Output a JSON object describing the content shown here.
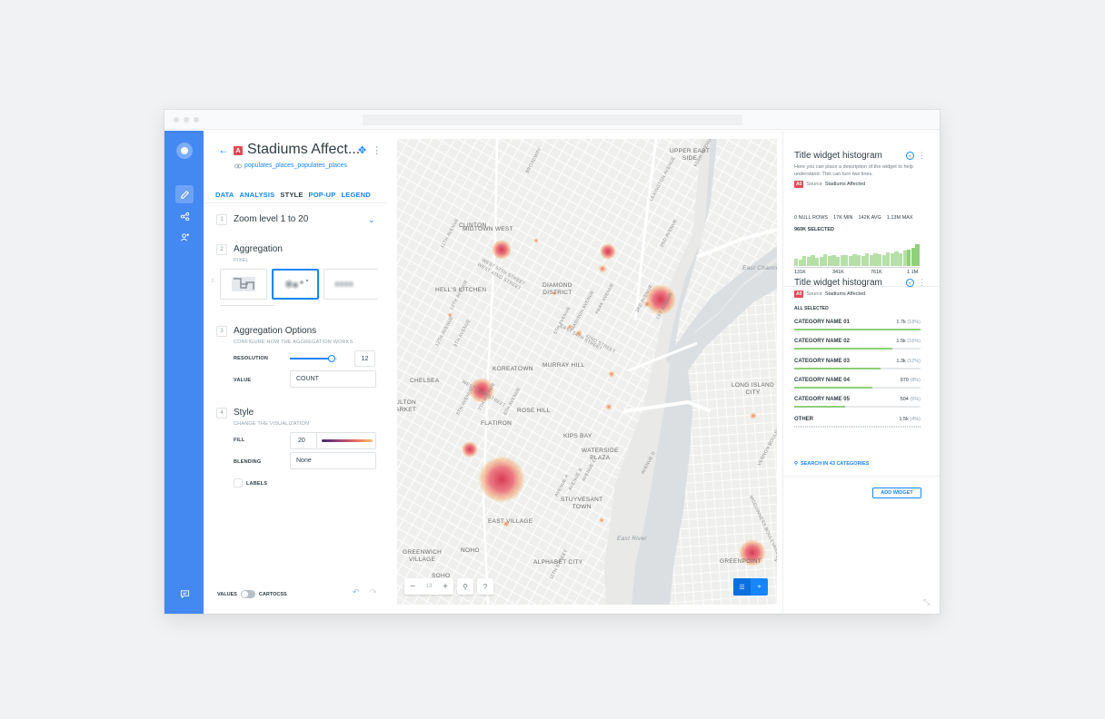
{
  "layer": {
    "back_icon": "arrow-left-icon",
    "badge": "A",
    "title": "Stadiums Affect...",
    "source": "populates_places_populates_places",
    "tabs": [
      "DATA",
      "ANALYSIS",
      "STYLE",
      "POP-UP",
      "LEGEND"
    ],
    "active_tab": "STYLE"
  },
  "sections": {
    "zoom": {
      "num": "1",
      "title": "Zoom level 1 to 20"
    },
    "aggregation": {
      "num": "2",
      "title": "Aggregation",
      "sub": "PIXEL",
      "prev_num": "3",
      "selected_option": "pixel-heatmap"
    },
    "options": {
      "num": "3",
      "title": "Aggregation Options",
      "sub": "CONFIGURE HOW THE AGGREGATION WORKS",
      "resolution_label": "RESOLUTION",
      "resolution_value": "12",
      "resolution_fraction": 0.89,
      "value_label": "VALUE",
      "value_value": "COUNT"
    },
    "style": {
      "num": "4",
      "title": "Style",
      "sub": "CHANGE THE VISUALIZATION",
      "fill_label": "FILL",
      "fill_value": "20",
      "blending_label": "BLENDING",
      "blending_value": "None",
      "labels_label": "LABELS"
    }
  },
  "footer": {
    "values_label": "VALUES",
    "cartocss_label": "CARTOCSS"
  },
  "map": {
    "labels": [
      {
        "t": "MIDTOWN WEST"
      },
      {
        "t": "CLINTON"
      },
      {
        "t": "HELL'S KITCHEN"
      },
      {
        "t": "DIAMOND DISTRICT"
      },
      {
        "t": "MURRAY HILL"
      },
      {
        "t": "KOREATOWN"
      },
      {
        "t": "CHELSEA"
      },
      {
        "t": "ROSE HILL"
      },
      {
        "t": "FLATIRON"
      },
      {
        "t": "KIPS BAY"
      },
      {
        "t": "WATERSIDE PLAZA"
      },
      {
        "t": "STUYVESANT TOWN"
      },
      {
        "t": "EAST VILLAGE"
      },
      {
        "t": "GREENWICH VILLAGE"
      },
      {
        "t": "NOHO"
      },
      {
        "t": "ALPHABET CITY"
      },
      {
        "t": "SOHO"
      },
      {
        "t": "GREENPOINT"
      },
      {
        "t": "LONG ISLAND CITY"
      },
      {
        "t": "ULTON ARKET"
      },
      {
        "t": "UPPER EAST SIDE"
      }
    ],
    "streets": [
      "BROADWAY",
      "11TH AVENUE",
      "10TH AVENUE",
      "9TH AVENUE",
      "8TH AVENUE",
      "7TH AVENUE",
      "6TH AVENUE",
      "5TH AVENUE",
      "MADISON AVENUE",
      "PARK AVENUE",
      "LEXINGTON AVENUE",
      "3RD AVENUE",
      "2ND AVENUE",
      "1ST AVENUE",
      "YORK AVENUE",
      "WEST 57TH STREET",
      "WEST 42ND STREET",
      "42ND STREET",
      "WEST 23RD STREET",
      "EAST 34TH STREET",
      "AVENUE A",
      "AVENUE B",
      "AVENUE C",
      "AVENUE D",
      "12TH AVENUE",
      "MCGUINNESS BOULEVARD",
      "11TH STREET",
      "VERNON BOULEVARD",
      "BEDFORD"
    ],
    "water": [
      "East River",
      "East Channel"
    ],
    "zoom": "13",
    "heat_color": "#e84a5f"
  },
  "widgets": {
    "histogram": {
      "title": "Title widget histogram",
      "description": "Here you can place a description of the widget to help understand. This can turn two lines.",
      "source_badge": "A0",
      "source_label": "Source",
      "source_name": "Stadiums Affected",
      "stats": [
        "0 NULL ROWS",
        "17K MIN",
        "142K AVG",
        "1.13M MAX"
      ],
      "selected": "960K SELECTED",
      "bars": [
        0.35,
        0.3,
        0.45,
        0.4,
        0.5,
        0.38,
        0.42,
        0.55,
        0.45,
        0.5,
        0.4,
        0.48,
        0.52,
        0.45,
        0.55,
        0.5,
        0.45,
        0.58,
        0.52,
        0.6,
        0.55,
        0.5,
        0.62,
        0.58,
        0.65,
        0.6,
        0.7,
        0.75,
        0.85,
        1.0
      ],
      "ticks": [
        "131K",
        "341K",
        "761K",
        "1.1M"
      ]
    },
    "category": {
      "title": "Title widget histogram",
      "source_badge": "A0",
      "source_label": "Source",
      "source_name": "Stadiums Affected",
      "all_selected": "ALL SELECTED",
      "items": [
        {
          "name": "CATEGORY NAME 01",
          "value": "1.7k",
          "pct": "(18%)",
          "frac": 1.0
        },
        {
          "name": "CATEGORY NAME 02",
          "value": "1.5k",
          "pct": "(16%)",
          "frac": 0.78
        },
        {
          "name": "CATEGORY NAME 03",
          "value": "1.3k",
          "pct": "(12%)",
          "frac": 0.68
        },
        {
          "name": "CATEGORY NAME 04",
          "value": "970",
          "pct": "(8%)",
          "frac": 0.62
        },
        {
          "name": "CATEGORY NAME 05",
          "value": "504",
          "pct": "(6%)",
          "frac": 0.4
        },
        {
          "name": "OTHER",
          "value": "1.5k",
          "pct": "(4%)",
          "frac": 0
        }
      ],
      "search": "SEARCH IN 43 CATEGORIES"
    },
    "add_widget": "ADD WIDGET"
  },
  "colors": {
    "accent": "#1785fb",
    "rail": "#4488f2",
    "bar": "#8ed07a",
    "badge": "#e34a55"
  }
}
